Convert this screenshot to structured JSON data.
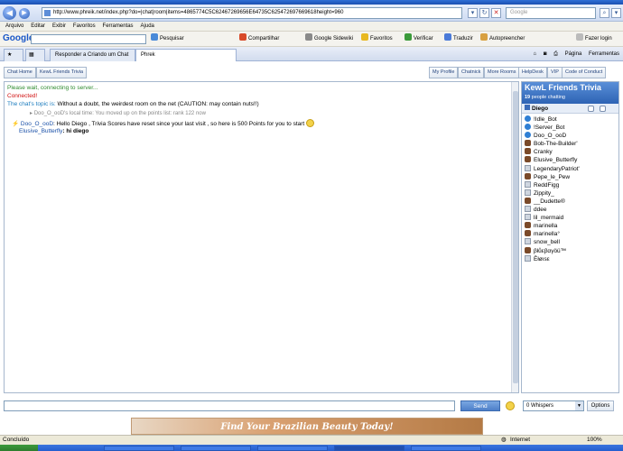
{
  "browser": {
    "address": "http://www.phreik.net/index.php?do=|chat|room|items=4865774C5C62467269656E64735C625472697669618height=960",
    "search_placeholder": "Google",
    "menu": [
      "Arquivo",
      "Editar",
      "Exibir",
      "Favoritos",
      "Ferramentas",
      "Ajuda"
    ],
    "google_bar": {
      "logo": "Google",
      "search_label": "Pesquisar",
      "items": [
        "Compartilhar",
        "Google Sidewiki",
        "Favoritos",
        "Verificar",
        "Traduzir",
        "Autopreencher",
        "Fazer login"
      ]
    },
    "tabs": [
      "Responder a Criando um Chat",
      "Phrek"
    ],
    "commands": [
      "Página",
      "Ferramentas"
    ]
  },
  "chat": {
    "toolbar_left": [
      "Chat Home",
      "KewL Friends Trivia"
    ],
    "toolbar_right": [
      "My Profile",
      "Chatnick",
      "More Rooms",
      "HelpDesk",
      "VIP",
      "Code of Conduct"
    ],
    "messages": {
      "wait": "Please wait, connecting to server...",
      "connected": "Connected!",
      "topic_label": "The chat's topic is:",
      "topic_text": "Without a doubt, the weirdest room on the net (CAUTION: may contain nuts!!)",
      "points_line": "Doo_O_ooD's local time: You moved up on the points list: rank 122 now",
      "bot_user": "Doo_O_ooD",
      "bot_text": ": Hello Diego , Trivia Scores have reset since your last visit , so here is 500 Points for you to start",
      "user_name": "Elusive_Butterfly",
      "user_text": ": hi diego"
    },
    "room": {
      "name": "KewL Friends Trivia",
      "count": "19",
      "count_label": "people chatting"
    },
    "current_user": "Diego",
    "users": [
      {
        "name": "!Idle_Bot",
        "icon": "bot"
      },
      {
        "name": "!Server_Bot",
        "icon": "bot"
      },
      {
        "name": "Doo_O_ooD",
        "icon": "bot"
      },
      {
        "name": "Bob-The-Builder'",
        "icon": "figure"
      },
      {
        "name": "Cranky",
        "icon": "figure"
      },
      {
        "name": "Elusive_Butterfly",
        "icon": "figure"
      },
      {
        "name": "LegendaryPatriot'",
        "icon": "image"
      },
      {
        "name": "Pepe_le_Pew",
        "icon": "figure"
      },
      {
        "name": "ReddFigg",
        "icon": "image"
      },
      {
        "name": "Zippity_",
        "icon": "image"
      },
      {
        "name": "__Dudette®",
        "icon": "figure"
      },
      {
        "name": "ddee",
        "icon": "image"
      },
      {
        "name": "lil_mermaid",
        "icon": "image"
      },
      {
        "name": "marinella",
        "icon": "figure"
      },
      {
        "name": "marinella°",
        "icon": "figure"
      },
      {
        "name": "snow_bell",
        "icon": "image"
      },
      {
        "name": "βłůεβαγöü™",
        "icon": "figure"
      },
      {
        "name": "Ĕłøısε",
        "icon": "image"
      }
    ],
    "send_label": "Send",
    "whisper_value": "0  Whispers",
    "options_label": "Options"
  },
  "banner_text": "Find Your Brazilian Beauty Today!",
  "status": {
    "left": "Concluído",
    "zone": "Internet",
    "zoom": "100%"
  },
  "colors": {
    "green": "#2e8b2e",
    "red": "#d01010",
    "topic": "#1a7bbd",
    "user": "#1a50a8"
  }
}
